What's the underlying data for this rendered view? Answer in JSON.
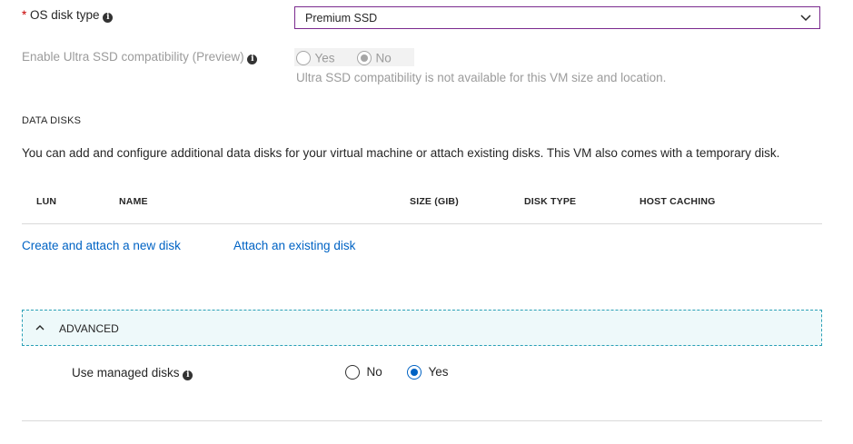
{
  "os_disk_type": {
    "required_mark": "*",
    "label": "OS disk type",
    "info_icon": "info-icon",
    "value": "Premium SSD",
    "dropdown_icon": "chevron-down-icon"
  },
  "ultra_ssd": {
    "label": "Enable Ultra SSD compatibility (Preview)",
    "info_icon": "info-icon",
    "options": [
      "Yes",
      "No"
    ],
    "selected": "No",
    "note": "Ultra SSD compatibility is not available for this VM size and location."
  },
  "data_disks": {
    "heading": "DATA DISKS",
    "description": "You can add and configure additional data disks for your virtual machine or attach existing disks. This VM also comes with a temporary disk.",
    "columns": [
      "LUN",
      "NAME",
      "SIZE (GIB)",
      "DISK TYPE",
      "HOST CACHING"
    ],
    "rows": [],
    "create_link": "Create and attach a new disk",
    "attach_link": "Attach an existing disk"
  },
  "advanced": {
    "label": "ADVANCED",
    "caret_icon": "chevron-up-icon",
    "managed_disks": {
      "label": "Use managed disks",
      "info_icon": "info-icon",
      "options": [
        "No",
        "Yes"
      ],
      "selected": "Yes"
    }
  },
  "colors": {
    "accent": "#0063c4",
    "required": "#c80000",
    "select_border": "#7a2a8e",
    "advanced_border": "#2aa0b6",
    "advanced_bg": "#eef9fa"
  }
}
